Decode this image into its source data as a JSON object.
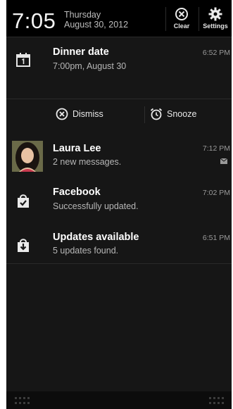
{
  "status": {
    "time": "7:05",
    "day": "Thursday",
    "date": "August 30, 2012"
  },
  "header_buttons": {
    "clear_label": "Clear",
    "settings_label": "Settings",
    "clear_icon": "close-circle-icon",
    "settings_icon": "gear-icon"
  },
  "notifications": [
    {
      "title": "Dinner date",
      "subtitle": "7:00pm, August 30",
      "time": "6:52 PM",
      "icon": "calendar-icon"
    },
    {
      "title": "Laura Lee",
      "subtitle": "2 new messages.",
      "time": "7:12 PM",
      "icon": "avatar",
      "badge_icon": "message-icon"
    },
    {
      "title": "Facebook",
      "subtitle": "Successfully updated.",
      "time": "7:02 PM",
      "icon": "shopping-bag-check-icon"
    },
    {
      "title": "Updates available",
      "subtitle": "5 updates found.",
      "time": "6:51 PM",
      "icon": "shopping-bag-download-icon"
    }
  ],
  "actions": {
    "dismiss_label": "Dismiss",
    "snooze_label": "Snooze",
    "dismiss_icon": "close-circle-icon",
    "snooze_icon": "alarm-clock-icon"
  },
  "colors": {
    "background": "#161616",
    "header": "#000000",
    "title": "#ffffff",
    "subtitle": "#b7b7b7"
  }
}
